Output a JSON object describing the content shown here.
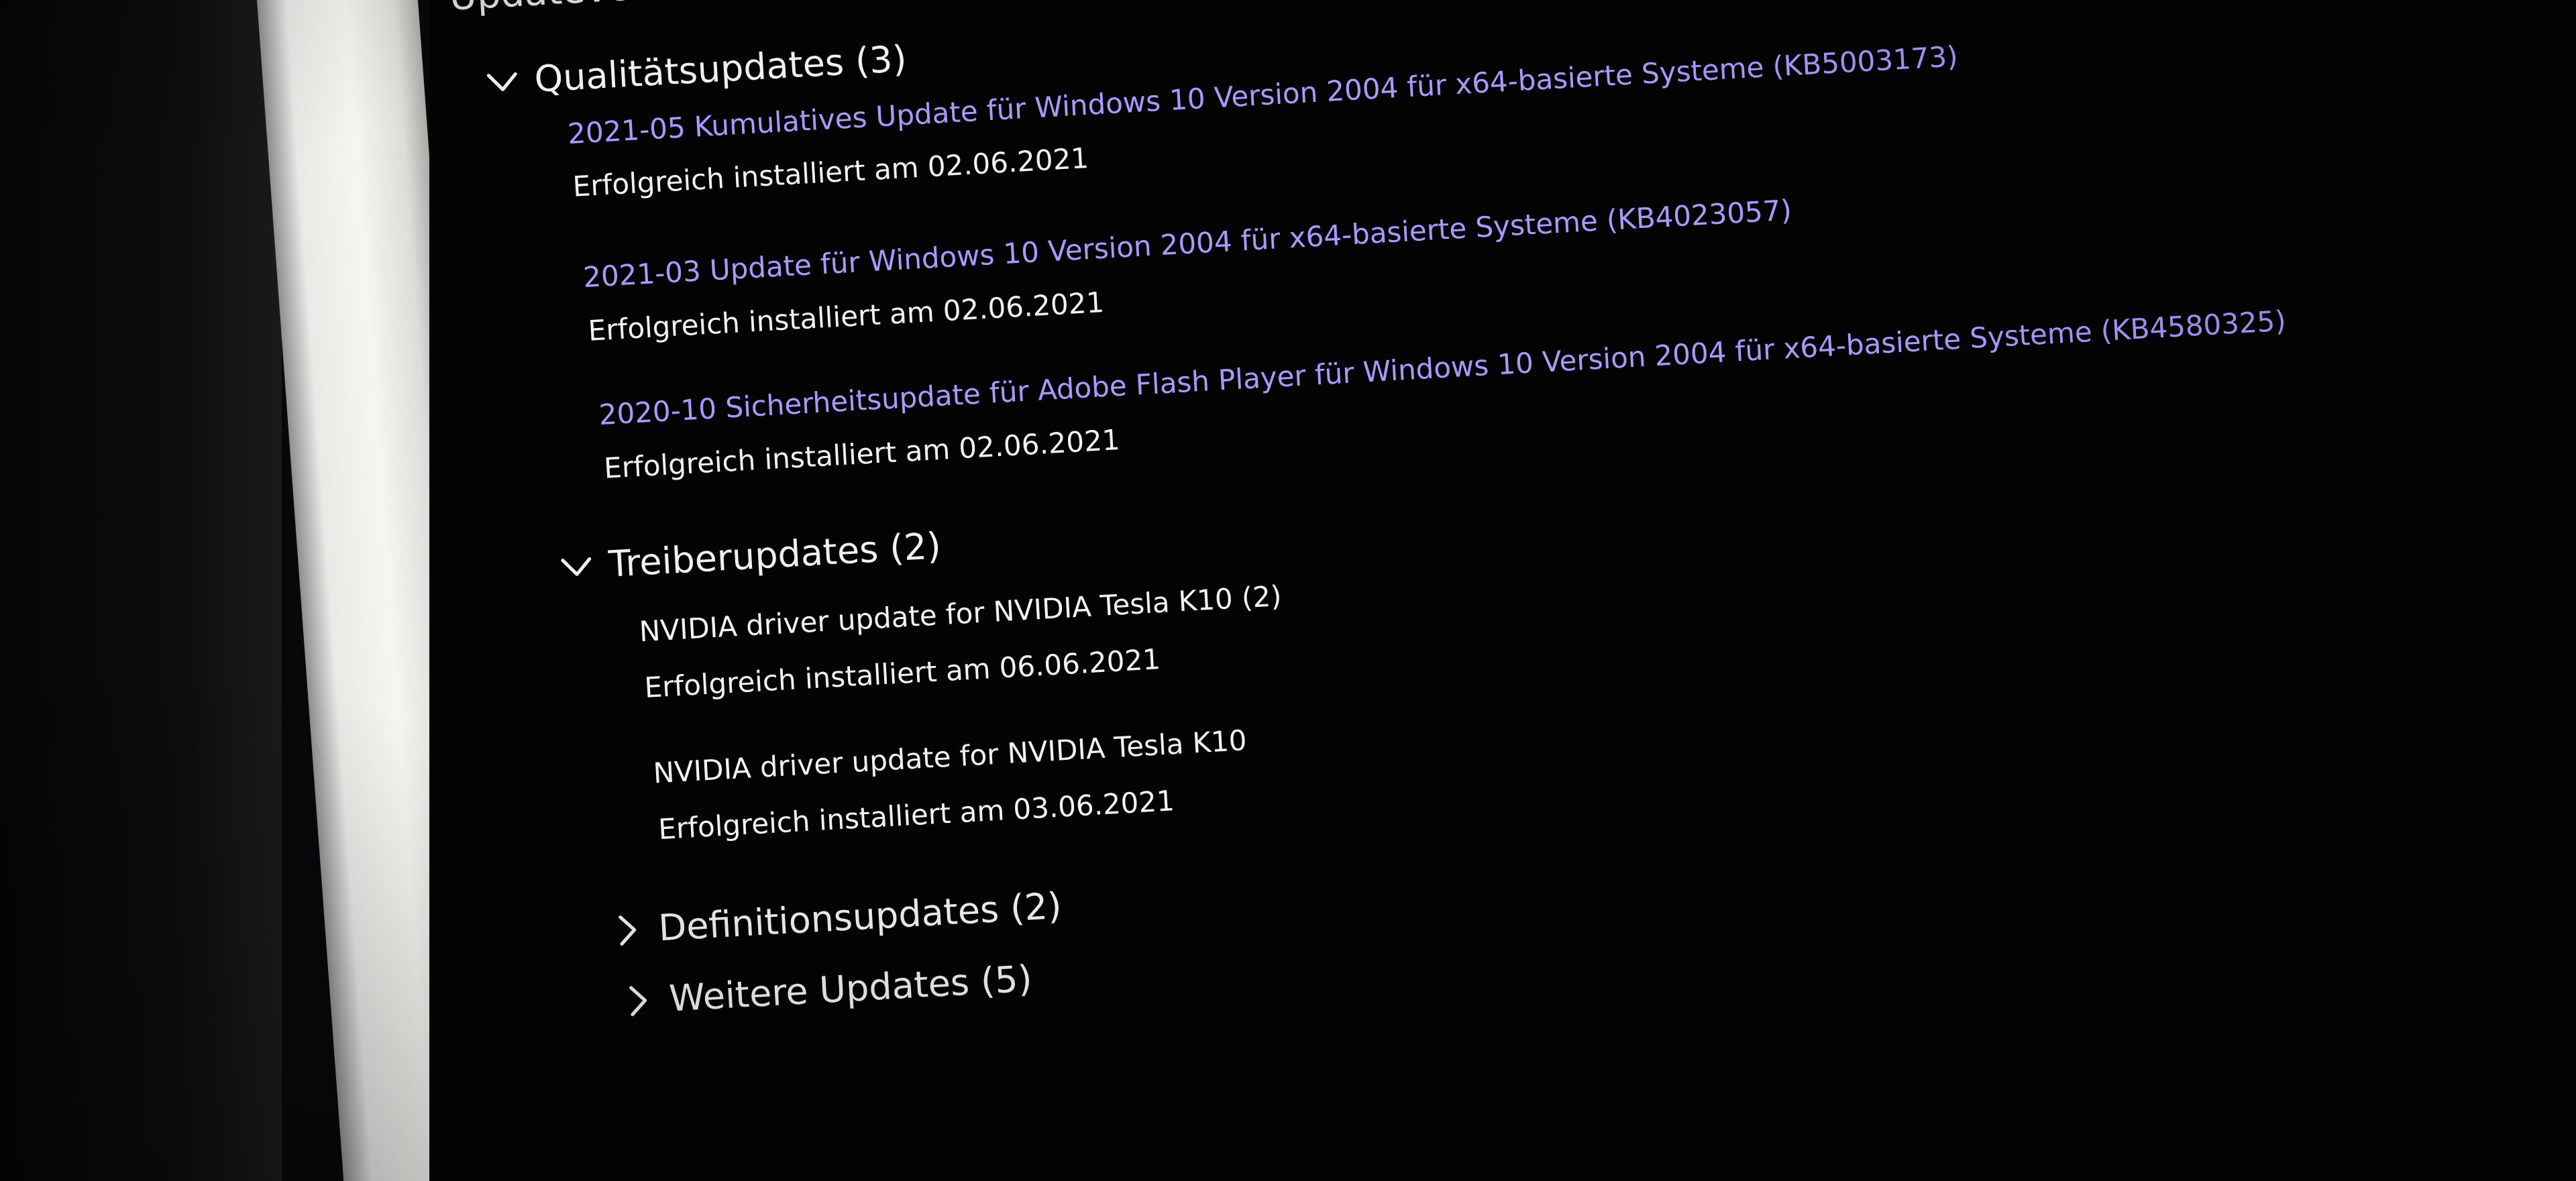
{
  "page": {
    "title": "Updateverlauf"
  },
  "sections": {
    "quality": {
      "label": "Qualitätsupdates (3)",
      "expanded": true,
      "items": [
        {
          "title": "2021-05 Kumulatives Update für Windows 10 Version 2004 für x64-basierte Systeme (KB5003173)",
          "status": "Erfolgreich installiert am 02.06.2021"
        },
        {
          "title": "2021-03 Update für Windows 10 Version 2004 für x64-basierte Systeme (KB4023057)",
          "status": "Erfolgreich installiert am 02.06.2021"
        },
        {
          "title": "2020-10 Sicherheitsupdate für Adobe Flash Player für Windows 10 Version 2004 für x64-basierte Systeme (KB4580325)",
          "status": "Erfolgreich installiert am 02.06.2021"
        }
      ]
    },
    "driver": {
      "label": "Treiberupdates (2)",
      "expanded": true,
      "items": [
        {
          "title": "NVIDIA driver update for NVIDIA Tesla K10 (2)",
          "status": "Erfolgreich installiert am 06.06.2021"
        },
        {
          "title": "NVIDIA driver update for NVIDIA Tesla K10",
          "status": "Erfolgreich installiert am 03.06.2021"
        }
      ]
    },
    "definition": {
      "label": "Definitionsupdates (2)",
      "expanded": false
    },
    "other": {
      "label": "Weitere Updates (5)",
      "expanded": false
    }
  },
  "colors": {
    "background": "#030304",
    "link": "#a79bff",
    "text": "#f2f2f2"
  },
  "icons": {
    "expanded": "chevron-down-icon",
    "collapsed": "chevron-right-icon"
  }
}
